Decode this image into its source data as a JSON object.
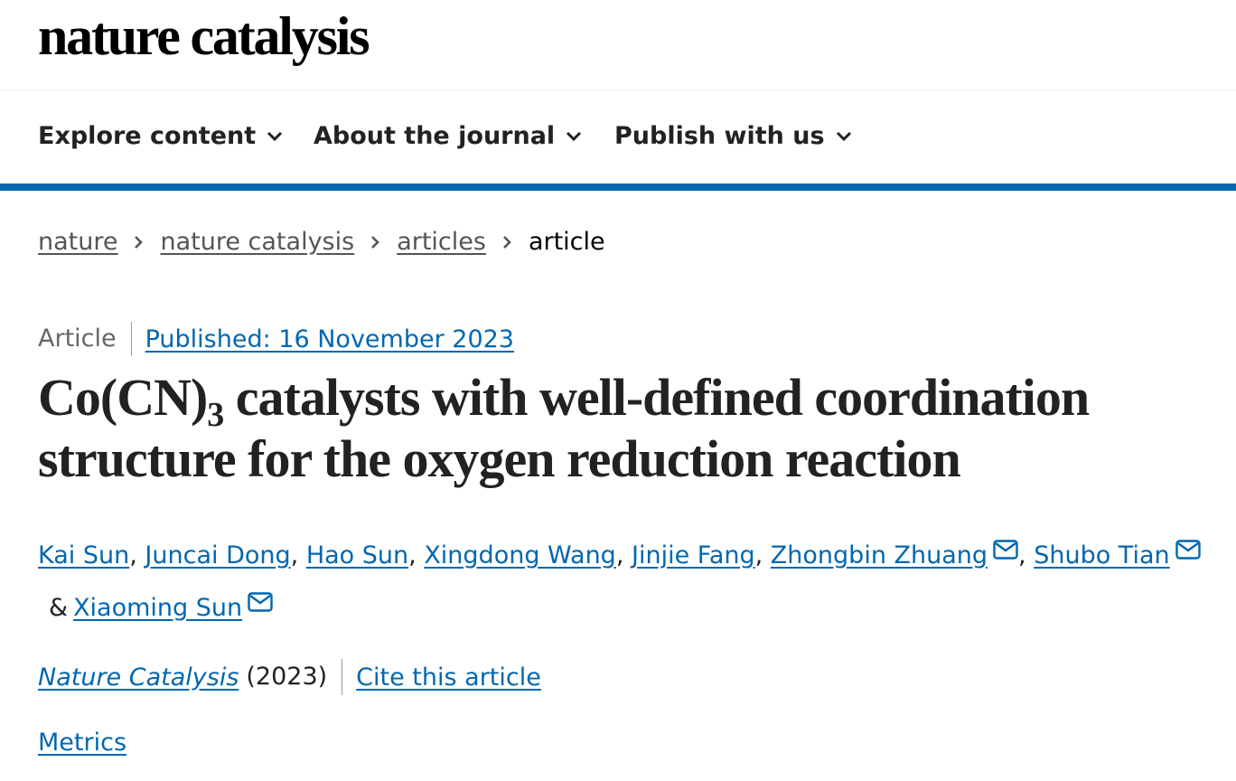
{
  "site": {
    "logo_text": "nature catalysis"
  },
  "nav": {
    "items": [
      {
        "label": "Explore content",
        "icon": "chevron-down-icon"
      },
      {
        "label": "About the journal",
        "icon": "chevron-down-icon"
      },
      {
        "label": "Publish with us",
        "icon": "chevron-down-icon"
      }
    ]
  },
  "breadcrumb": {
    "items": [
      "nature",
      "nature catalysis",
      "articles"
    ],
    "current": "article",
    "separator_icon": "chevron-right-icon"
  },
  "article": {
    "type": "Article",
    "published": "Published: 16 November 2023",
    "title_part1": "Co(CN)",
    "title_sub": "3",
    "title_part2": " catalysts with well-defined coordination structure for the oxygen reduction reaction",
    "authors": [
      {
        "name": "Kai Sun"
      },
      {
        "name": "Juncai Dong"
      },
      {
        "name": "Hao Sun"
      },
      {
        "name": "Xingdong Wang"
      },
      {
        "name": "Jinjie Fang"
      },
      {
        "name": "Zhongbin Zhuang",
        "icon": "mail-icon"
      },
      {
        "name": "Shubo Tian",
        "icon": "mail-icon"
      },
      {
        "name": "Xiaoming Sun",
        "icon": "mail-icon"
      }
    ],
    "author_separator": ", ",
    "author_final_separator": "&",
    "journal": "Nature Catalysis",
    "year": "(2023)",
    "cite_label": "Cite this article",
    "metrics_label": "Metrics"
  },
  "colors": {
    "link": "#0067b1",
    "accent_bar": "#0067b1",
    "text": "#222222"
  }
}
